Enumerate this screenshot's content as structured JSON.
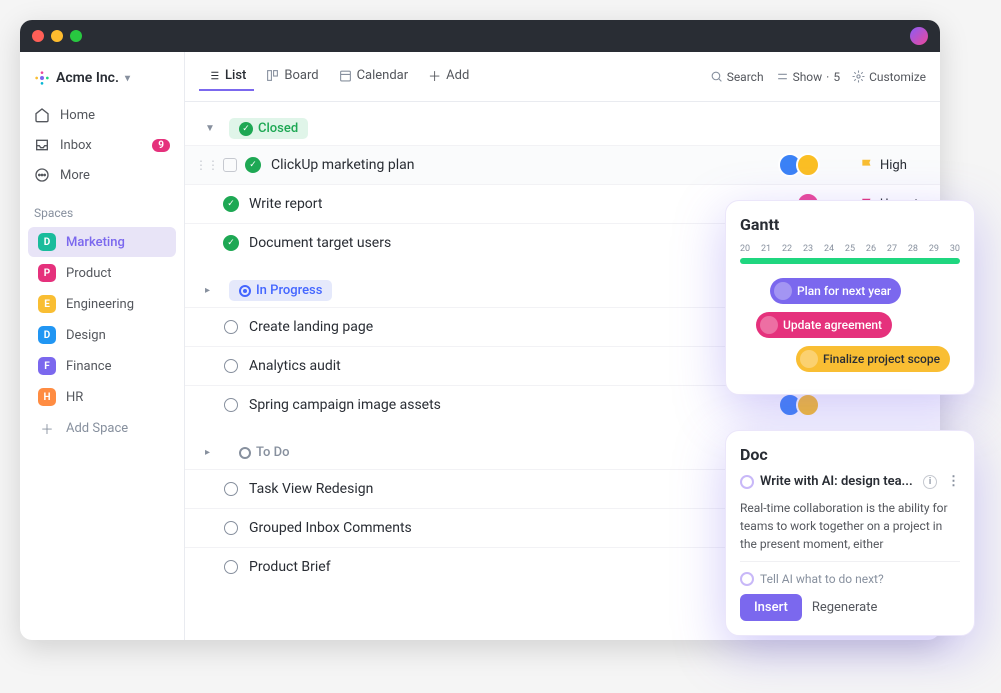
{
  "workspace_name": "Acme Inc.",
  "nav": {
    "home": "Home",
    "inbox": "Inbox",
    "inbox_badge": "9",
    "more": "More"
  },
  "spaces_label": "Spaces",
  "spaces": [
    {
      "chip": "D",
      "label": "Marketing",
      "color": "#1abc9c"
    },
    {
      "chip": "P",
      "label": "Product",
      "color": "#e5317c"
    },
    {
      "chip": "E",
      "label": "Engineering",
      "color": "#f9be33"
    },
    {
      "chip": "D",
      "label": "Design",
      "color": "#2196f3"
    },
    {
      "chip": "F",
      "label": "Finance",
      "color": "#7b68ee"
    },
    {
      "chip": "H",
      "label": "HR",
      "color": "#ff8c42"
    }
  ],
  "add_space_label": "Add Space",
  "views": {
    "list": "List",
    "board": "Board",
    "calendar": "Calendar",
    "add": "Add"
  },
  "toolbar": {
    "search": "Search",
    "show": "Show",
    "show_count": "5",
    "customize": "Customize"
  },
  "groups": [
    {
      "status": "Closed",
      "tasks": [
        {
          "name": "ClickUp marketing plan",
          "avatars": [
            "#3b82f6",
            "#fbbf24"
          ],
          "priority": "High",
          "priority_color": "#f9be33"
        },
        {
          "name": "Write report",
          "avatars": [
            "#ec4899"
          ],
          "priority": "Urgent",
          "priority_color": "#e5317c"
        },
        {
          "name": "Document target users",
          "avatars": [
            "#fbbf24",
            "#3b82f6"
          ],
          "priority": "",
          "priority_color": ""
        }
      ]
    },
    {
      "status": "In Progress",
      "tasks": [
        {
          "name": "Create landing page",
          "avatars": [
            "#3b82f6"
          ],
          "priority": "",
          "priority_color": ""
        },
        {
          "name": "Analytics audit",
          "avatars": [
            "#ec4899",
            "#fbbf24"
          ],
          "priority": "",
          "priority_color": ""
        },
        {
          "name": "Spring campaign image assets",
          "avatars": [
            "#3b82f6",
            "#fbbf24"
          ],
          "priority": "",
          "priority_color": ""
        }
      ]
    },
    {
      "status": "To Do",
      "tasks": [
        {
          "name": "Task View Redesign",
          "avatars": [
            "#fbbf24"
          ],
          "priority": "",
          "priority_color": ""
        },
        {
          "name": "Grouped Inbox Comments",
          "avatars": [
            "#ec4899",
            "#fbbf24"
          ],
          "priority": "",
          "priority_color": ""
        },
        {
          "name": "Product Brief",
          "avatars": [
            "#06b6d4"
          ],
          "priority": "",
          "priority_color": ""
        }
      ]
    }
  ],
  "gantt": {
    "title": "Gantt",
    "dates": [
      "20",
      "21",
      "22",
      "23",
      "24",
      "25",
      "26",
      "27",
      "28",
      "29",
      "30"
    ],
    "bars": [
      {
        "label": "Plan for next year"
      },
      {
        "label": "Update agreement"
      },
      {
        "label": "Finalize project scope"
      }
    ]
  },
  "doc": {
    "title": "Doc",
    "ai_title": "Write with AI: design tea...",
    "body": "Real-time collaboration is the ability for teams to work together on a project in the present moment, either",
    "prompt": "Tell AI what to do next?",
    "insert": "Insert",
    "regenerate": "Regenerate"
  }
}
